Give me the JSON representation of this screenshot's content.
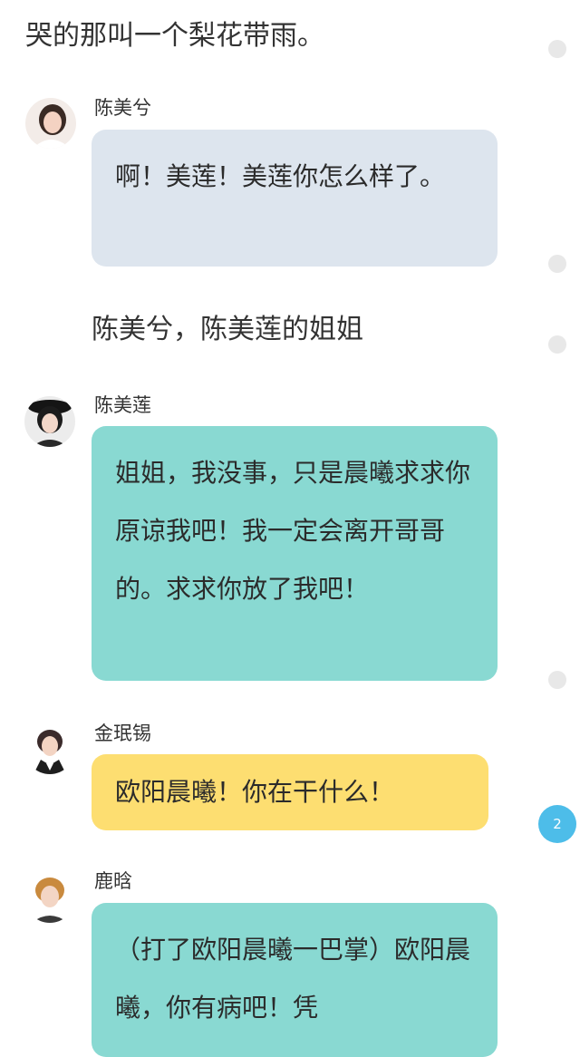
{
  "story": {
    "opening_narration": "哭的那叫一个梨花带雨。",
    "narration_2": "陈美兮，陈美莲的姐姐",
    "messages": [
      {
        "speaker": "陈美兮",
        "text": "啊！美莲！美莲你怎么样了。",
        "bubble_color": "#dde5ee",
        "avatar": "avatar-chen-meixi"
      },
      {
        "speaker": "陈美莲",
        "text": "姐姐，我没事，只是晨曦求求你原谅我吧！我一定会离开哥哥的。求求你放了我吧！",
        "bubble_color": "#89d9d2",
        "avatar": "avatar-chen-meilian"
      },
      {
        "speaker": "金珉锡",
        "text": "欧阳晨曦！你在干什么！",
        "bubble_color": "#fdde71",
        "avatar": "avatar-jin-minxi"
      },
      {
        "speaker": "鹿晗",
        "text": "（打了欧阳晨曦一巴掌）欧阳晨曦，你有病吧！凭",
        "bubble_color": "#89d9d2",
        "avatar": "avatar-lu-han"
      }
    ]
  },
  "comment_badge": {
    "count": "2",
    "color": "#4dbde9"
  }
}
